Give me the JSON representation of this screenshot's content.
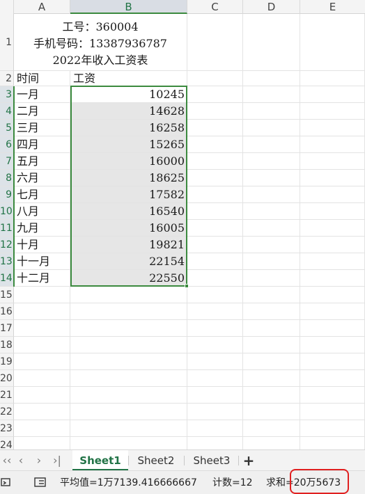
{
  "columns": [
    "A",
    "B",
    "C",
    "D",
    "E"
  ],
  "title_block": {
    "line1": "工号：360004",
    "line2": "手机号码：13387936787",
    "line3": "2022年收入工资表"
  },
  "header_row": {
    "row_number": "2",
    "col_a": "时间",
    "col_b": "工资"
  },
  "rows": [
    {
      "row_number": "3",
      "month": "一月",
      "salary": "10245"
    },
    {
      "row_number": "4",
      "month": "二月",
      "salary": "14628"
    },
    {
      "row_number": "5",
      "month": "三月",
      "salary": "16258"
    },
    {
      "row_number": "6",
      "month": "四月",
      "salary": "15265"
    },
    {
      "row_number": "7",
      "month": "五月",
      "salary": "16000"
    },
    {
      "row_number": "8",
      "month": "六月",
      "salary": "18625"
    },
    {
      "row_number": "9",
      "month": "七月",
      "salary": "17582"
    },
    {
      "row_number": "10",
      "month": "八月",
      "salary": "16540"
    },
    {
      "row_number": "11",
      "month": "九月",
      "salary": "16005"
    },
    {
      "row_number": "12",
      "month": "十月",
      "salary": "19821"
    },
    {
      "row_number": "13",
      "month": "十一月",
      "salary": "22154"
    },
    {
      "row_number": "14",
      "month": "十二月",
      "salary": "22550"
    }
  ],
  "empty_row_numbers": [
    "15",
    "16",
    "17",
    "18",
    "19",
    "20",
    "21",
    "22",
    "23",
    "24"
  ],
  "title_row_number": "1",
  "sheet_tabs": [
    {
      "label": "Sheet1",
      "active": true
    },
    {
      "label": "Sheet2",
      "active": false
    },
    {
      "label": "Sheet3",
      "active": false
    }
  ],
  "status": {
    "average": "平均值=1万7139.416666667",
    "count": "计数=12",
    "sum": "求和=20万5673"
  },
  "colors": {
    "selection_green": "#3b8a3e",
    "tab_green": "#217346",
    "highlight_red": "#e02020"
  },
  "icons": {
    "nav_first": "chevron-left-double",
    "nav_prev": "chevron-left",
    "nav_next": "chevron-right",
    "nav_last": "chevron-right-bar",
    "add_sheet": "plus",
    "status_left": "macro-icon",
    "status_view": "list-view-icon"
  }
}
